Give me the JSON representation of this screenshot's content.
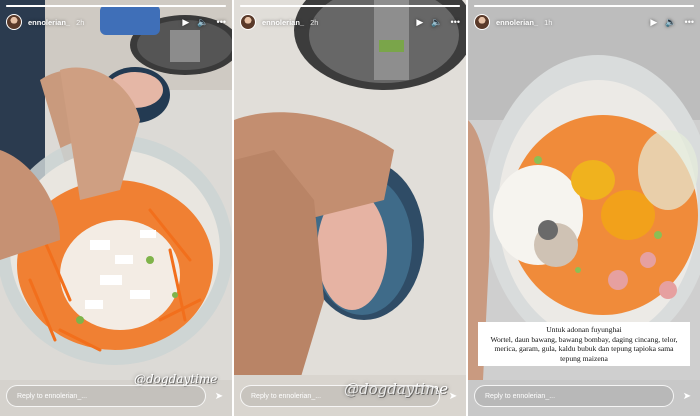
{
  "stories": [
    {
      "username": "ennolerian_",
      "time": "2h",
      "reply_placeholder": "Reply to ennolerian_...",
      "sticker": "@dogdaytime",
      "progress": 1.0
    },
    {
      "username": "ennolerian_",
      "time": "2h",
      "reply_placeholder": "Reply to ennolerian_...",
      "sticker": "@dogdaytime",
      "progress": 1.0
    },
    {
      "username": "ennolerian_",
      "time": "1h",
      "reply_placeholder": "Reply to ennolerian_...",
      "progress": 1.0,
      "caption_title": "Untuk adonan fuyunghai",
      "caption_body": "Wortel, daun bawang, bawang bombay, daging cincang, telor, merica, garam, gula, kaldu bubuk dan tepung tapioka sama tepung maizena"
    }
  ],
  "icons": {
    "play": "play-icon",
    "mute": "speaker-icon",
    "more": "more-icon",
    "send": "send-icon"
  },
  "colors": {
    "accent_text": "#ffffff",
    "carrot": "#f0782a",
    "bowl_blue": "#243c57"
  }
}
